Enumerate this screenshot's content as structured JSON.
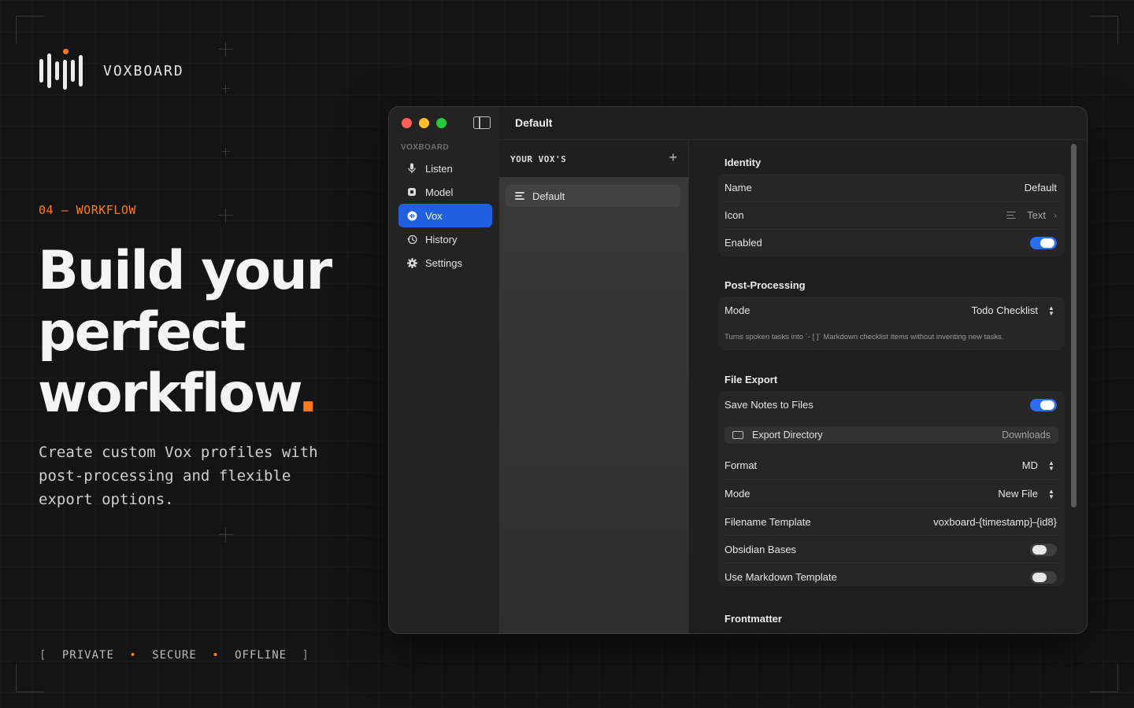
{
  "brand": {
    "name": "VOXBOARD"
  },
  "hero": {
    "section_tag": "04 — WORKFLOW",
    "headline_line1": "Build your",
    "headline_line2": "perfect",
    "headline_line3": "workflow",
    "headline_period": ".",
    "subtext": "Create custom Vox profiles with post-processing and flexible export options.",
    "tagline": {
      "open": "[",
      "items": [
        "PRIVATE",
        "SECURE",
        "OFFLINE"
      ],
      "separator": "•",
      "close": "]"
    }
  },
  "colors": {
    "accent": "#ff7a1a",
    "selection": "#1f5fe0",
    "toggle_on": "#2a6ff2"
  },
  "window": {
    "title": "Default",
    "sidebar": {
      "section_label": "VOXBOARD",
      "items": [
        {
          "label": "Listen",
          "icon": "microphone-icon",
          "active": false
        },
        {
          "label": "Model",
          "icon": "chip-icon",
          "active": false
        },
        {
          "label": "Vox",
          "icon": "vox-icon",
          "active": true
        },
        {
          "label": "History",
          "icon": "history-icon",
          "active": false
        },
        {
          "label": "Settings",
          "icon": "gear-icon",
          "active": false
        }
      ]
    },
    "list": {
      "header": "YOUR VOX'S",
      "add_label": "+",
      "items": [
        {
          "label": "Default",
          "icon": "text-lines-icon"
        }
      ]
    },
    "identity": {
      "title": "Identity",
      "name_label": "Name",
      "name_value": "Default",
      "icon_label": "Icon",
      "icon_value": "Text",
      "enabled_label": "Enabled",
      "enabled": true
    },
    "post_processing": {
      "title": "Post-Processing",
      "mode_label": "Mode",
      "mode_value": "Todo Checklist",
      "helper": "Turns spoken tasks into `- [ ]` Markdown checklist items without inventing new tasks."
    },
    "file_export": {
      "title": "File Export",
      "save_label": "Save Notes to Files",
      "save_enabled": true,
      "dir_label": "Export Directory",
      "dir_value": "Downloads",
      "format_label": "Format",
      "format_value": "MD",
      "mode_label": "Mode",
      "mode_value": "New File",
      "filename_label": "Filename Template",
      "filename_value": "voxboard-{timestamp}-{id8}",
      "obsidian_label": "Obsidian Bases",
      "obsidian_enabled": false,
      "markdown_label": "Use Markdown Template",
      "markdown_enabled": false
    },
    "frontmatter": {
      "title": "Frontmatter"
    }
  }
}
